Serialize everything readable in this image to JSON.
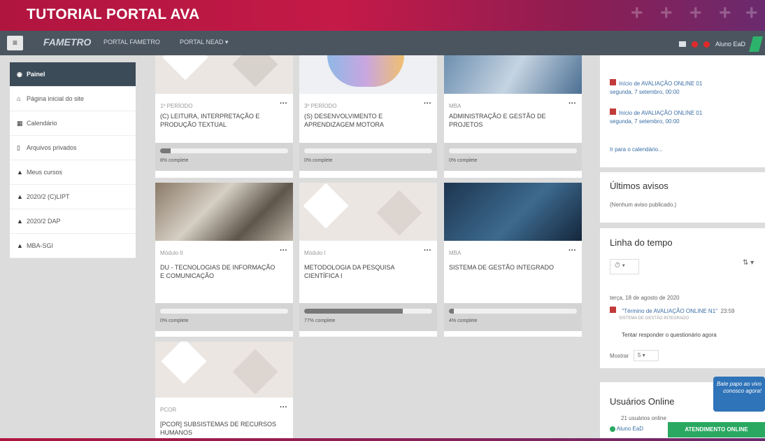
{
  "banner": {
    "title": "TUTORIAL PORTAL AVA"
  },
  "navbar": {
    "brand": "FAMETRO",
    "links": [
      "PORTAL FAMETRO",
      "PORTAL NEAD ▾"
    ],
    "user": "Aluno EaD"
  },
  "sidebar": {
    "items": [
      {
        "label": "Painel",
        "icon": "dashboard-icon"
      },
      {
        "label": "Página inicial do site",
        "icon": "home-icon"
      },
      {
        "label": "Calendário",
        "icon": "calendar-icon"
      },
      {
        "label": "Arquivos privados",
        "icon": "file-icon"
      },
      {
        "label": "Meus cursos",
        "icon": "graduation-cap-icon"
      },
      {
        "label": "2020/2 (C)LIPT",
        "icon": "graduation-cap-icon"
      },
      {
        "label": "2020/2 DAP",
        "icon": "graduation-cap-icon"
      },
      {
        "label": "MBA-SGI",
        "icon": "graduation-cap-icon"
      }
    ]
  },
  "courses": [
    {
      "category": "1º PERÍODO",
      "name": "(C) LEITURA, INTERPRETAÇÃO E PRODUÇÃO TEXTUAL",
      "progress_text": "8% complete",
      "progress": 8
    },
    {
      "category": "3º PERÍODO",
      "name": "(S) DESENVOLVIMENTO E APRENDIZAGEM MOTORA",
      "progress_text": "0% complete",
      "progress": 0
    },
    {
      "category": "MBA",
      "name": "ADMINISTRAÇÃO E GESTÃO DE PROJETOS",
      "progress_text": "0% complete",
      "progress": 0
    },
    {
      "category": "Módulo II",
      "name": "DU - TECNOLOGIAS DE INFORMAÇÃO E COMUNICAÇÃO",
      "progress_text": "0% complete",
      "progress": 0
    },
    {
      "category": "Módulo I",
      "name": "METODOLOGIA DA PESQUISA CIENTÍFICA I",
      "progress_text": "77% complete",
      "progress": 77
    },
    {
      "category": "MBA",
      "name": "SISTEMA DE GESTÃO INTEGRADO",
      "progress_text": "4% complete",
      "progress": 4
    },
    {
      "category": "PCOR",
      "name": "[PCOR] SUBSISTEMAS DE RECURSOS HUMANOS",
      "progress_text": "",
      "progress": 0
    }
  ],
  "events": [
    {
      "title": "Início de AVALIAÇÃO ONLINE 01",
      "date": "segunda, 7 setembro, 00:00"
    },
    {
      "title": "Início de AVALIAÇÃO ONLINE 01",
      "date": "segunda, 7 setembro, 00:00"
    }
  ],
  "calendar_link": "Ir para o calendário...",
  "avisos": {
    "title": "Últimos avisos",
    "empty": "(Nenhum aviso publicado.)"
  },
  "timeline": {
    "title": "Linha do tempo",
    "date": "terça, 18 de agosto de 2020",
    "item_title": "\"Término de AVALIAÇÃO ONLINE N1\"",
    "item_time": "23:59",
    "item_course": "SISTEMA DE GESTÃO INTEGRADO",
    "action": "Tentar responder o questionário agora",
    "show_label": "Mostrar",
    "show_value": "5 ▾"
  },
  "online": {
    "title": "Usuários Online",
    "count_text": "21 usuários online",
    "user": "Aluno EaD"
  },
  "chat": {
    "bubble": "Bate papo ao vivo conosco agora!",
    "button": "ATENDIMENTO ONLINE"
  }
}
